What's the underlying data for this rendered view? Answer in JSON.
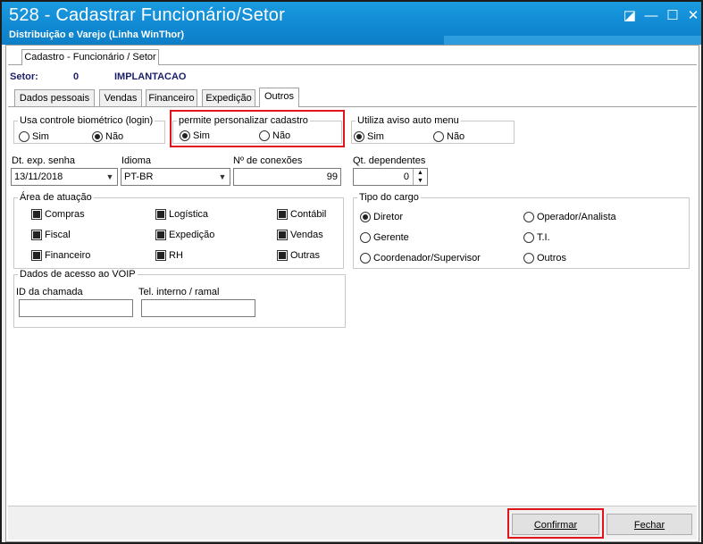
{
  "window": {
    "title": "528 - Cadastrar Funcionário/Setor",
    "subtitle": "Distribuição e Varejo (Linha WinThor)",
    "controls": {
      "restore": "◪",
      "minimize": "—",
      "maximize": "☐",
      "close": "✕"
    }
  },
  "main_tab": "Cadastro - Funcionário / Setor",
  "setor": {
    "label": "Setor:",
    "code": "0",
    "name": "IMPLANTACAO"
  },
  "tabs": [
    "Dados pessoais",
    "Vendas",
    "Financeiro",
    "Expedição",
    "Outros"
  ],
  "active_tab": "Outros",
  "biometrico": {
    "label": "Usa controle biométrico (login)",
    "sim": "Sim",
    "nao": "Não",
    "selected": "nao"
  },
  "personalizar": {
    "label": "permite personalizar cadastro",
    "sim": "Sim",
    "nao": "Não",
    "selected": "sim"
  },
  "aviso_menu": {
    "label": "Utiliza aviso auto menu",
    "sim": "Sim",
    "nao": "Não",
    "selected": "sim"
  },
  "dt_exp_senha": {
    "label": "Dt. exp. senha",
    "value": "13/11/2018"
  },
  "idioma": {
    "label": "Idioma",
    "value": "PT-BR"
  },
  "conexoes": {
    "label": "Nº de conexões",
    "value": "99"
  },
  "dependentes": {
    "label": "Qt. dependentes",
    "value": "0"
  },
  "area_atuacao": {
    "label": "Área de atuação",
    "items": [
      "Compras",
      "Logística",
      "Contábil",
      "Fiscal",
      "Expedição",
      "Vendas",
      "Financeiro",
      "RH",
      "Outras"
    ]
  },
  "tipo_cargo": {
    "label": "Tipo do cargo",
    "items": [
      "Diretor",
      "Operador/Analista",
      "Gerente",
      "T.I.",
      "Coordenador/Supervisor",
      "Outros"
    ],
    "selected": "Diretor"
  },
  "voip": {
    "label": "Dados de acesso ao VOIP",
    "id_label": "ID da chamada",
    "id_value": "",
    "tel_label": "Tel. interno / ramal",
    "tel_value": ""
  },
  "buttons": {
    "confirm": "Confirmar",
    "close": "Fechar"
  },
  "icons": {
    "dropdown": "▼",
    "spin_up": "▲",
    "spin_down": "▼"
  },
  "colors": {
    "titlebar": "#1b9be0",
    "highlight": "#e0141a"
  }
}
